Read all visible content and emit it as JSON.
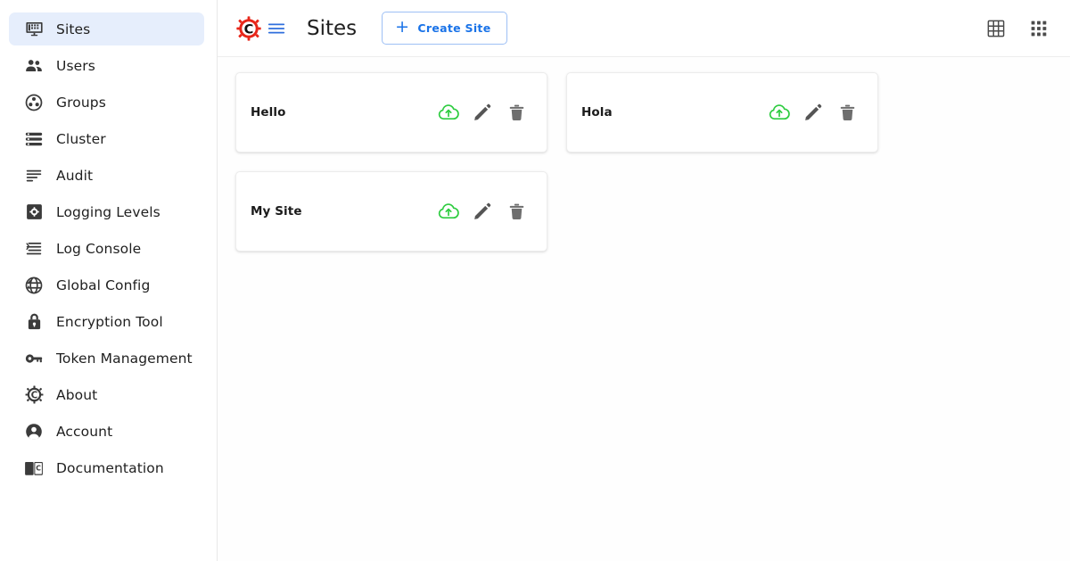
{
  "sidebar": {
    "items": [
      {
        "label": "Sites",
        "icon": "monitor-sites-icon",
        "active": true
      },
      {
        "label": "Users",
        "icon": "users-icon",
        "active": false
      },
      {
        "label": "Groups",
        "icon": "groups-icon",
        "active": false
      },
      {
        "label": "Cluster",
        "icon": "cluster-icon",
        "active": false
      },
      {
        "label": "Audit",
        "icon": "audit-list-icon",
        "active": false
      },
      {
        "label": "Logging Levels",
        "icon": "logging-levels-icon",
        "active": false
      },
      {
        "label": "Log Console",
        "icon": "log-console-icon",
        "active": false
      },
      {
        "label": "Global Config",
        "icon": "globe-icon",
        "active": false
      },
      {
        "label": "Encryption Tool",
        "icon": "lock-icon",
        "active": false
      },
      {
        "label": "Token Management",
        "icon": "key-icon",
        "active": false
      },
      {
        "label": "About",
        "icon": "gear-c-icon",
        "active": false
      },
      {
        "label": "Account",
        "icon": "account-person-icon",
        "active": false
      },
      {
        "label": "Documentation",
        "icon": "book-icon",
        "active": false
      }
    ]
  },
  "topbar": {
    "logo_icon": "crafter-gear-logo-icon",
    "menu_icon": "hamburger-menu-icon",
    "title": "Sites",
    "create_button": {
      "label": "Create Site",
      "plus": "+"
    },
    "actions": [
      {
        "icon": "grid-table-view-icon"
      },
      {
        "icon": "apps-grid-icon"
      }
    ]
  },
  "main": {
    "cards": [
      {
        "title": "Hello",
        "actions": [
          {
            "icon": "cloud-upload-publish-icon",
            "kind": "publish"
          },
          {
            "icon": "pencil-edit-icon",
            "kind": "edit"
          },
          {
            "icon": "trash-delete-icon",
            "kind": "delete"
          }
        ]
      },
      {
        "title": "Hola",
        "actions": [
          {
            "icon": "cloud-upload-publish-icon",
            "kind": "publish"
          },
          {
            "icon": "pencil-edit-icon",
            "kind": "edit"
          },
          {
            "icon": "trash-delete-icon",
            "kind": "delete"
          }
        ]
      },
      {
        "title": "My Site",
        "actions": [
          {
            "icon": "cloud-upload-publish-icon",
            "kind": "publish"
          },
          {
            "icon": "pencil-edit-icon",
            "kind": "edit"
          },
          {
            "icon": "trash-delete-icon",
            "kind": "delete"
          }
        ]
      }
    ]
  },
  "colors": {
    "accent_blue": "#1a73e8",
    "active_item_bg": "#e6eefc",
    "logo_red": "#e8271a",
    "publish_green": "#2ecc40",
    "icon_gray": "#555555",
    "border_gray": "#ececec"
  }
}
